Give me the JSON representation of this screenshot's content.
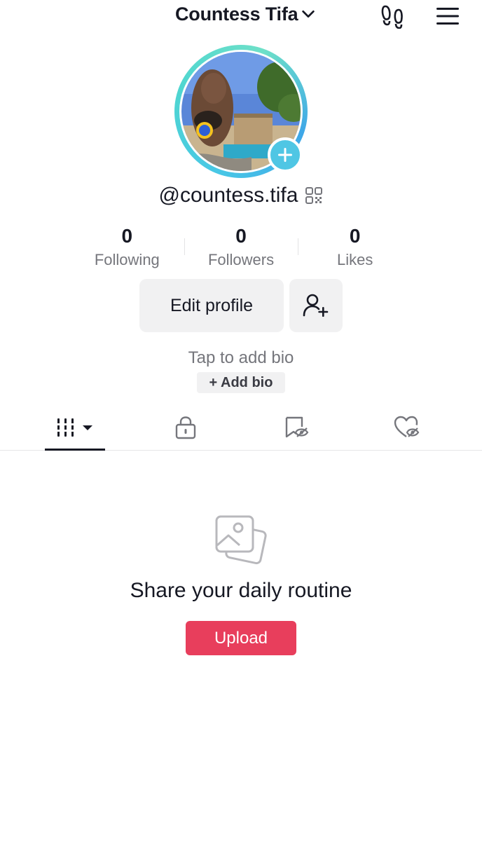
{
  "header": {
    "account_name": "Countess Tifa",
    "dropdown_icon": "chevron-down-icon",
    "footprints_icon": "footprints-icon",
    "menu_icon": "hamburger-menu-icon"
  },
  "profile": {
    "username": "@countess.tifa",
    "qr_icon": "qr-code-icon",
    "avatar_add_icon": "plus-icon",
    "accent_color": "#4fc6e4"
  },
  "stats": [
    {
      "value": "0",
      "label": "Following"
    },
    {
      "value": "0",
      "label": "Followers"
    },
    {
      "value": "0",
      "label": "Likes"
    }
  ],
  "actions": {
    "edit_profile_label": "Edit profile",
    "add_friends_icon": "add-user-icon"
  },
  "bio": {
    "hint": "Tap to add bio",
    "add_label": "+ Add bio"
  },
  "tabs": [
    {
      "name": "videos",
      "icon": "grid-icon",
      "active": true
    },
    {
      "name": "private",
      "icon": "lock-icon",
      "active": false
    },
    {
      "name": "reposts",
      "icon": "bookmark-hidden-icon",
      "active": false
    },
    {
      "name": "liked",
      "icon": "heart-hidden-icon",
      "active": false
    }
  ],
  "empty_state": {
    "icon": "photos-icon",
    "title": "Share your daily routine",
    "button_label": "Upload",
    "button_color": "#e83e5c"
  }
}
